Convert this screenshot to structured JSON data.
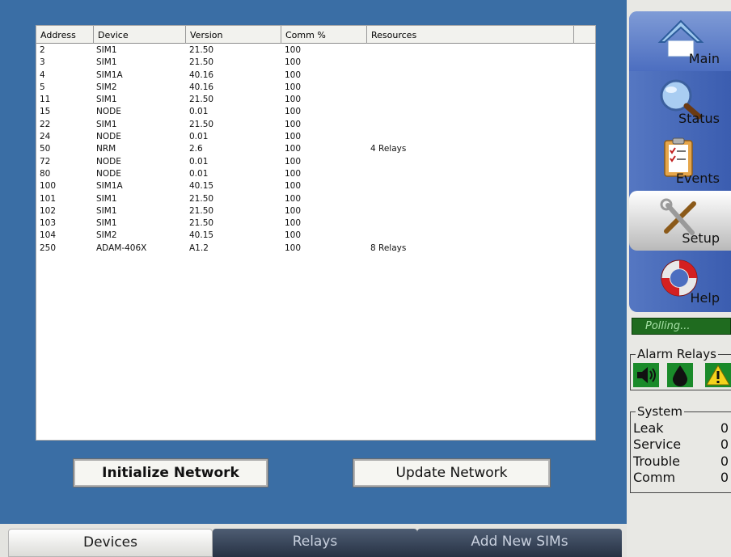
{
  "device_table": {
    "columns": [
      "Address",
      "Device",
      "Version",
      "Comm %",
      "Resources"
    ],
    "rows": [
      [
        "2",
        "SIM1",
        "21.50",
        "100",
        ""
      ],
      [
        "3",
        "SIM1",
        "21.50",
        "100",
        ""
      ],
      [
        "4",
        "SIM1A",
        "40.16",
        "100",
        ""
      ],
      [
        "5",
        "SIM2",
        "40.16",
        "100",
        ""
      ],
      [
        "11",
        "SIM1",
        "21.50",
        "100",
        ""
      ],
      [
        "15",
        "NODE",
        "0.01",
        "100",
        ""
      ],
      [
        "22",
        "SIM1",
        "21.50",
        "100",
        ""
      ],
      [
        "24",
        "NODE",
        "0.01",
        "100",
        ""
      ],
      [
        "50",
        "NRM",
        "2.6",
        "100",
        "4 Relays"
      ],
      [
        "72",
        "NODE",
        "0.01",
        "100",
        ""
      ],
      [
        "80",
        "NODE",
        "0.01",
        "100",
        ""
      ],
      [
        "100",
        "SIM1A",
        "40.15",
        "100",
        ""
      ],
      [
        "101",
        "SIM1",
        "21.50",
        "100",
        ""
      ],
      [
        "102",
        "SIM1",
        "21.50",
        "100",
        ""
      ],
      [
        "103",
        "SIM1",
        "21.50",
        "100",
        ""
      ],
      [
        "104",
        "SIM2",
        "40.15",
        "100",
        ""
      ],
      [
        "250",
        "ADAM-406X",
        "A1.2",
        "100",
        "8 Relays"
      ]
    ]
  },
  "buttons": {
    "initialize": "Initialize Network",
    "update": "Update Network"
  },
  "tabs": {
    "devices": "Devices",
    "relays": "Relays",
    "add_new_sims": "Add New SIMs",
    "active": "Devices"
  },
  "nav": {
    "main": "Main",
    "status": "Status",
    "events": "Events",
    "setup": "Setup",
    "help": "Help",
    "active": "Setup"
  },
  "polling": "Polling...",
  "alarm_relays": {
    "title": "Alarm Relays",
    "icons": [
      "speaker-icon",
      "leak-drop-icon",
      "warning-icon"
    ]
  },
  "system": {
    "title": "System",
    "rows": [
      {
        "label": "Leak",
        "value": "0"
      },
      {
        "label": "Service",
        "value": "0"
      },
      {
        "label": "Trouble",
        "value": "0"
      },
      {
        "label": "Comm",
        "value": "0"
      }
    ]
  },
  "colors": {
    "panel_blue": "#3a6ea5",
    "nav_blue": "#4c6ec0",
    "polling_green": "#1f6b1f",
    "relay_green": "#1a8a2a",
    "tab_dark": "#273244"
  }
}
